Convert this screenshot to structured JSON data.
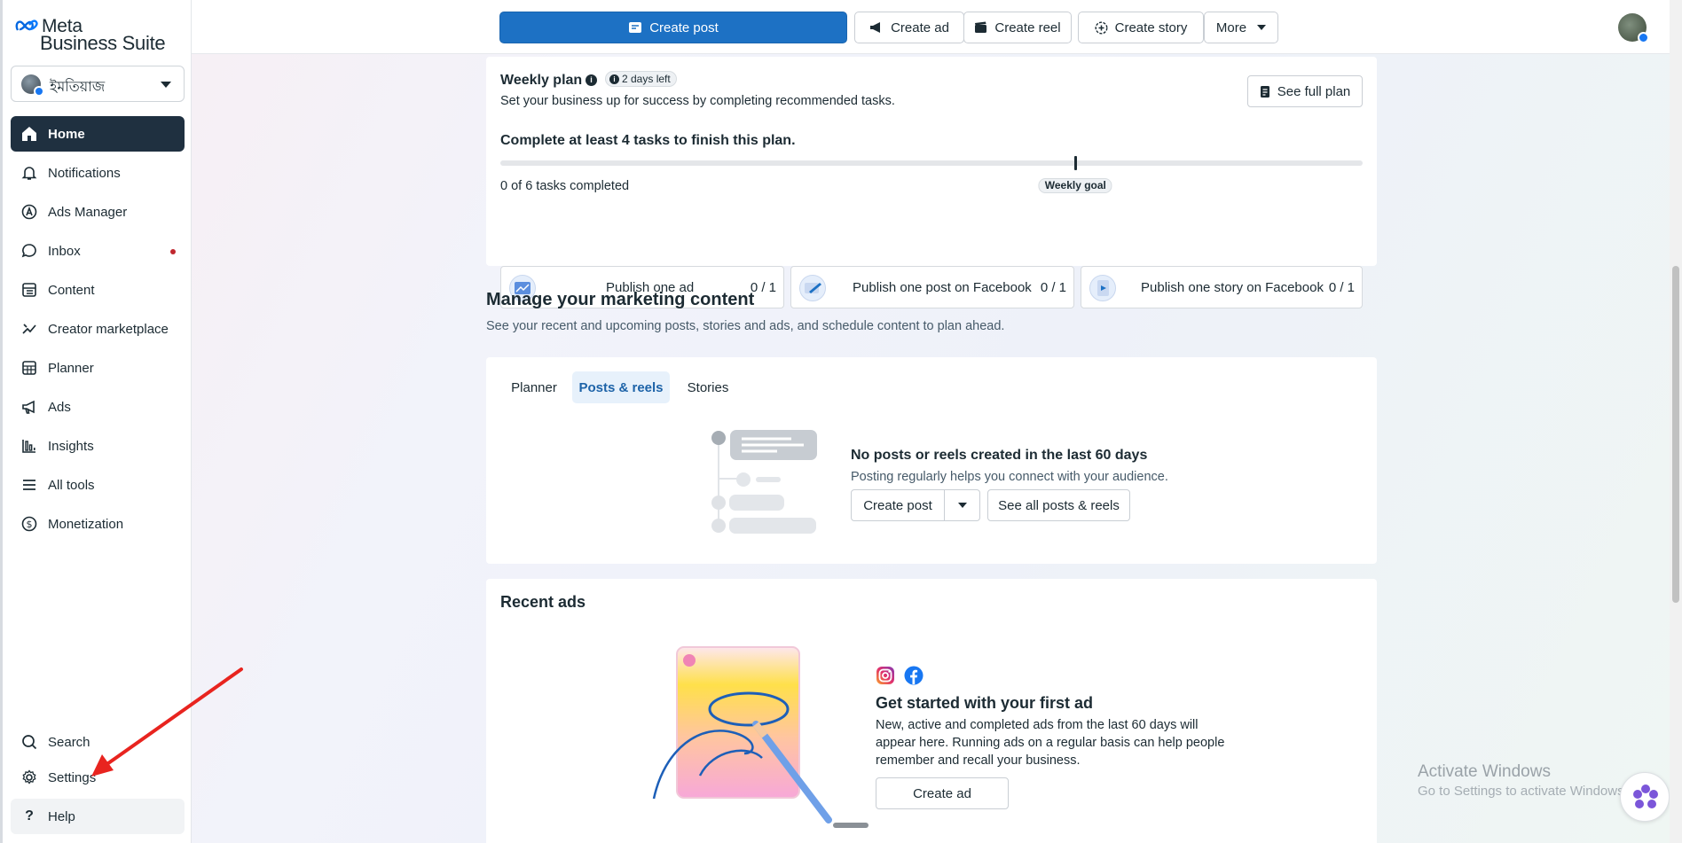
{
  "sidebar": {
    "brand_top": "Meta",
    "brand_bottom": "Business Suite",
    "account_name": "ইমতিয়াজ",
    "items": [
      {
        "label": "Home",
        "icon": "home-icon"
      },
      {
        "label": "Notifications",
        "icon": "bell-icon"
      },
      {
        "label": "Ads Manager",
        "icon": "ads-manager-icon"
      },
      {
        "label": "Inbox",
        "icon": "chat-bubble-icon"
      },
      {
        "label": "Content",
        "icon": "content-icon"
      },
      {
        "label": "Creator marketplace",
        "icon": "creator-marketplace-icon"
      },
      {
        "label": "Planner",
        "icon": "calendar-grid-icon"
      },
      {
        "label": "Ads",
        "icon": "megaphone-icon"
      },
      {
        "label": "Insights",
        "icon": "bar-chart-icon"
      },
      {
        "label": "All tools",
        "icon": "menu-icon"
      },
      {
        "label": "Monetization",
        "icon": "dollar-icon"
      }
    ],
    "bottom_items": [
      {
        "label": "Search",
        "icon": "search-icon"
      },
      {
        "label": "Settings",
        "icon": "gear-icon"
      },
      {
        "label": "Help",
        "icon": "question-icon"
      }
    ]
  },
  "topbar": {
    "create_post": "Create post",
    "create_ad": "Create ad",
    "create_reel": "Create reel",
    "create_story": "Create story",
    "more": "More"
  },
  "weekly_plan": {
    "title": "Weekly plan",
    "badge": "2 days left",
    "subtitle": "Set your business up for success by completing recommended tasks.",
    "see_full_plan": "See full plan",
    "goal_text": "Complete at least 4 tasks to finish this plan.",
    "progress_text": "0 of 6 tasks completed",
    "progress_fraction": 0,
    "goal_marker_fraction": 0.667,
    "goal_label": "Weekly goal",
    "tasks": [
      {
        "label": "Publish one ad",
        "count": "0 / 1"
      },
      {
        "label": "Publish one post on Facebook",
        "count": "0 / 1"
      },
      {
        "label": "Publish one story on Facebook",
        "count": "0 / 1"
      }
    ]
  },
  "marketing": {
    "title": "Manage your marketing content",
    "subtitle": "See your recent and upcoming posts, stories and ads, and schedule content to plan ahead.",
    "tabs": [
      "Planner",
      "Posts & reels",
      "Stories"
    ],
    "empty_title": "No posts or reels created in the last 60 days",
    "empty_subtitle": "Posting regularly helps you connect with your audience.",
    "create_post": "Create post",
    "see_all": "See all posts & reels"
  },
  "recent_ads": {
    "title": "Recent ads",
    "heading": "Get started with your first ad",
    "body_1": "New, active and completed ads from the last 60 days will",
    "body_2": "appear here. Running ads on a regular basis can help people",
    "body_3": "remember and recall your business.",
    "create_ad": "Create ad"
  },
  "watermark": {
    "line1": "Activate Windows",
    "line2": "Go to Settings to activate Windows."
  },
  "colors": {
    "primary": "#1d71c4",
    "nav_active": "#1f3040",
    "arrow": "#e8241f"
  }
}
